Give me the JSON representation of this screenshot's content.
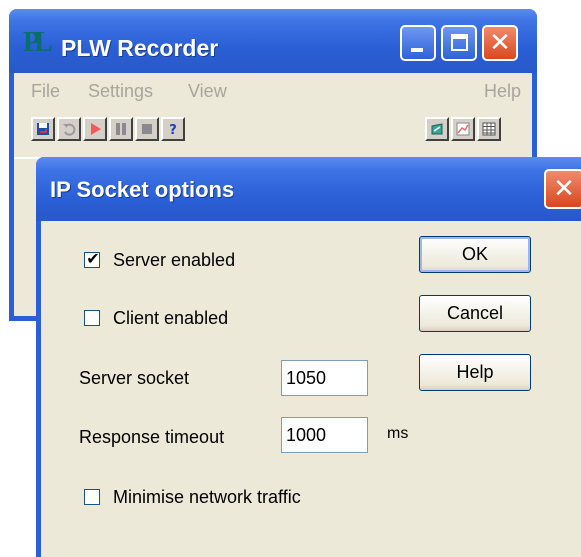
{
  "main_window": {
    "title": "PLW Recorder",
    "logo_text": "PL",
    "menu": [
      "File",
      "Settings",
      "View",
      "Help"
    ],
    "toolbar_left": [
      "save-icon",
      "undo-icon",
      "record-icon",
      "pause-icon",
      "stop-icon",
      "help-icon"
    ],
    "toolbar_right": [
      "open-file-icon",
      "chart-icon",
      "table-icon"
    ]
  },
  "dialog": {
    "title": "IP Socket options",
    "server_enabled": {
      "label": "Server enabled",
      "checked": true
    },
    "client_enabled": {
      "label": "Client enabled",
      "checked": false
    },
    "server_socket": {
      "label": "Server socket",
      "value": "1050"
    },
    "response_timeout": {
      "label": "Response timeout",
      "value": "1000",
      "unit": "ms"
    },
    "minimise_traffic": {
      "label": "Minimise network traffic",
      "checked": false
    },
    "buttons": {
      "ok": "OK",
      "cancel": "Cancel",
      "help": "Help"
    }
  },
  "colors": {
    "titlebar_blue": "#2a5fd6",
    "dialog_face": "#ece9d8",
    "close_red": "#d9481f"
  }
}
